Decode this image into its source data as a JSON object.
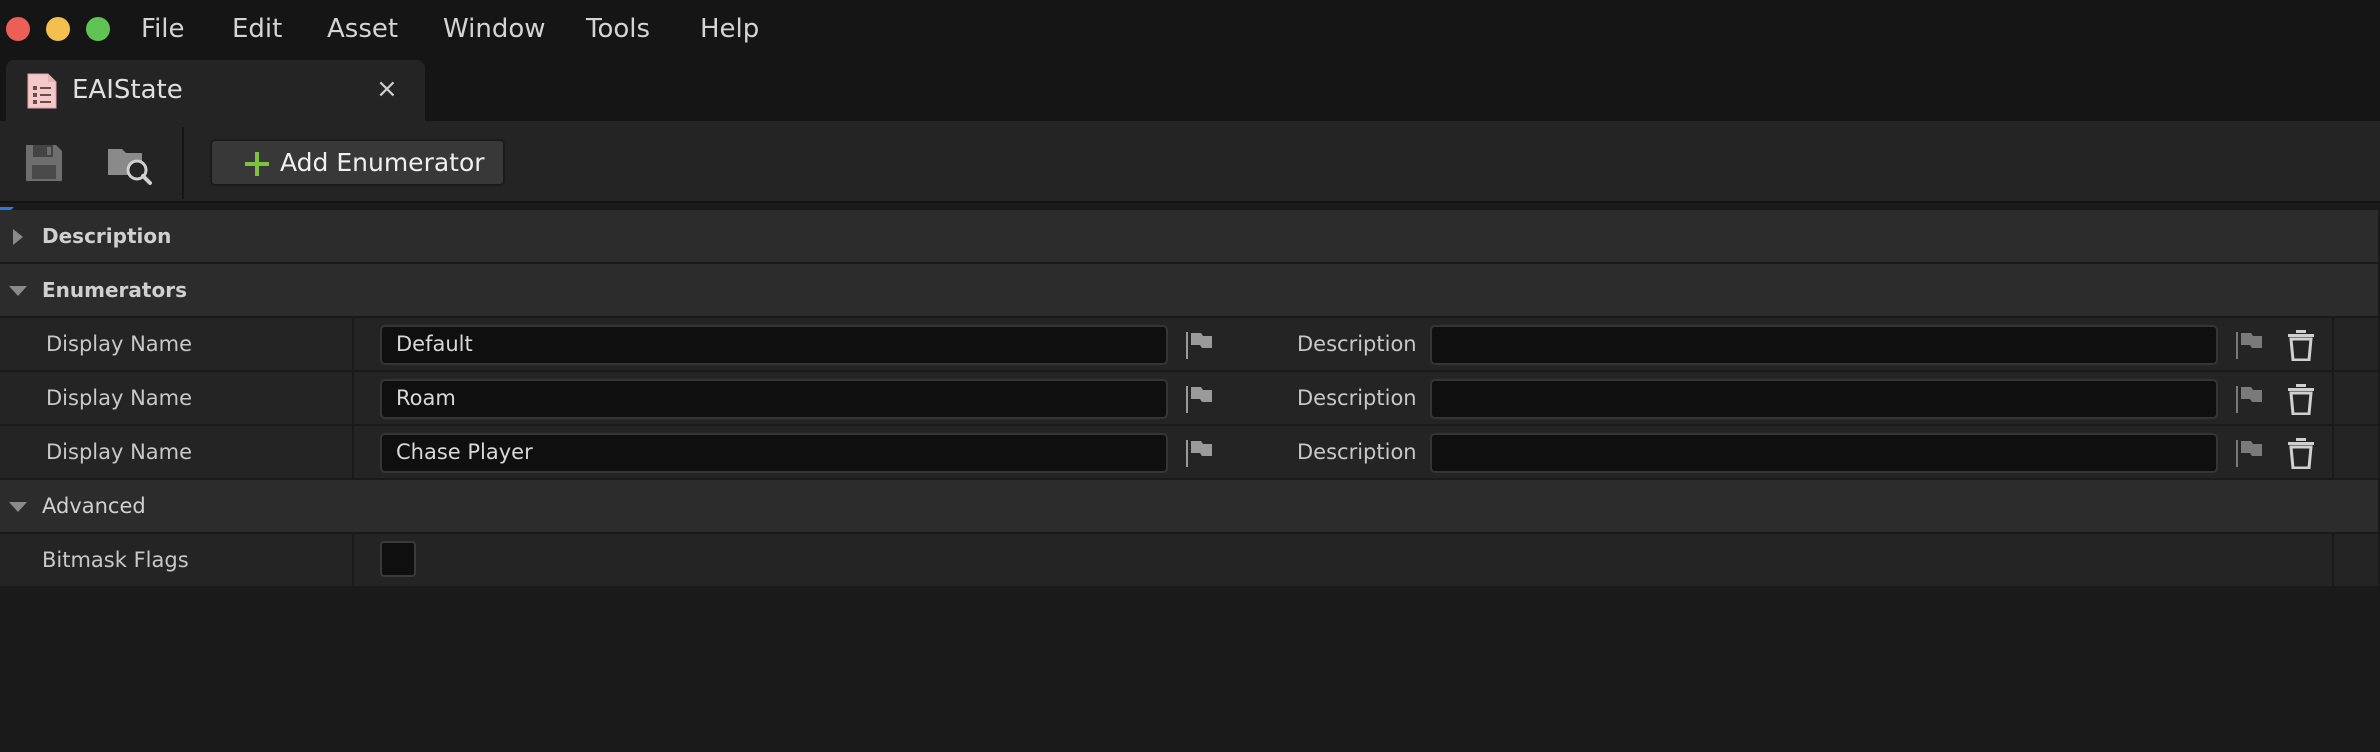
{
  "menu": {
    "items": [
      "File",
      "Edit",
      "Asset",
      "Window",
      "Tools",
      "Help"
    ]
  },
  "tab": {
    "title": "EAIState",
    "close_glyph": "×",
    "icon": "enum-asset-icon"
  },
  "toolbar": {
    "save_icon": "save-icon",
    "browse_icon": "browse-to-asset-icon",
    "add_enumerator_label": "Add Enumerator",
    "add_icon": "plus-icon",
    "accent_color": "#7fc241"
  },
  "details": {
    "categories": {
      "description": "Description",
      "enumerators": "Enumerators",
      "advanced": "Advanced"
    },
    "enumerators": [
      {
        "display_name_label": "Display Name",
        "display_name_value": "Default",
        "description_label": "Description",
        "description_value": ""
      },
      {
        "display_name_label": "Display Name",
        "display_name_value": "Roam",
        "description_label": "Description",
        "description_value": ""
      },
      {
        "display_name_label": "Display Name",
        "display_name_value": "Chase Player",
        "description_label": "Description",
        "description_value": ""
      }
    ],
    "advanced": {
      "bitmask_flags_label": "Bitmask Flags",
      "bitmask_flags_checked": false
    }
  },
  "colors": {
    "background": "#1a1a1a",
    "selection_marker": "#2a78e0"
  }
}
